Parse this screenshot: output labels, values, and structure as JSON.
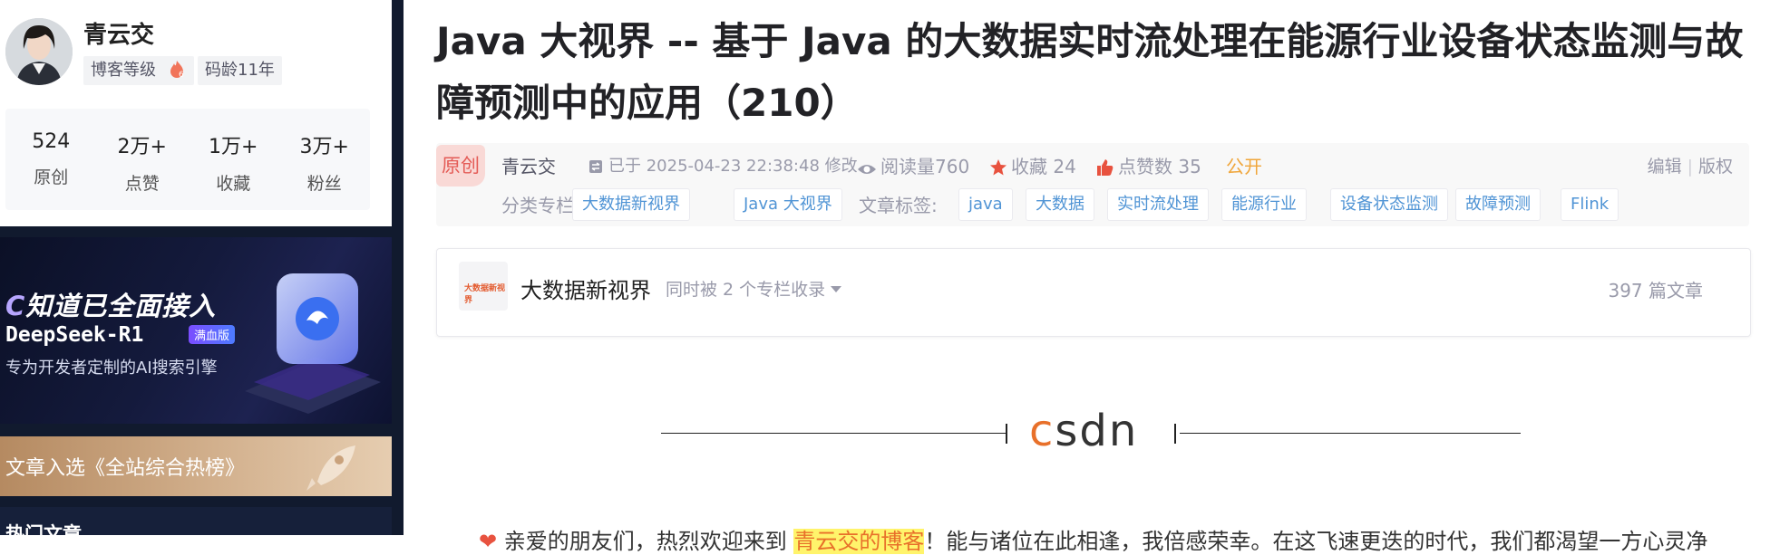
{
  "author": {
    "name": "青云交",
    "level_label": "博客等级",
    "age_label": "码龄11年"
  },
  "stats": [
    {
      "value": "524",
      "label": "原创"
    },
    {
      "value": "2万+",
      "label": "点赞"
    },
    {
      "value": "1万+",
      "label": "收藏"
    },
    {
      "value": "3万+",
      "label": "粉丝"
    }
  ],
  "ad": {
    "line1": "知道已全面接入",
    "line2": "DeepSeek-R1",
    "badge": "满血版",
    "line3": "专为开发者定制的AI搜索引擎"
  },
  "hot_banner": {
    "text": "文章入选《全站综合热榜》"
  },
  "sidebar_heading": "热门文章",
  "article": {
    "title": "Java 大视界 -- 基于 Java 的大数据实时流处理在能源行业设备状态监测与故障预测中的应用（210）",
    "original_badge": "原创",
    "author": "青云交",
    "time": "已于 2025-04-23 22:38:48 修改",
    "views": "阅读量760",
    "favorites": "收藏 24",
    "likes": "点赞数 35",
    "visibility": "公开",
    "edit": "编辑",
    "copyright": "版权",
    "category_label": "分类专栏:",
    "categories": [
      "大数据新视界",
      "Java 大视界"
    ],
    "tag_label": "文章标签:",
    "tags": [
      "java",
      "大数据",
      "实时流处理",
      "能源行业",
      "设备状态监测",
      "故障预测",
      "Flink"
    ]
  },
  "column": {
    "logo_text": "大数据新视界",
    "name": "大数据新视界",
    "included": "同时被 2 个专栏收录",
    "count": "397 篇文章"
  },
  "divider_logo": "csdn",
  "intro": {
    "before": "亲爱的朋友们，热烈欢迎来到 ",
    "highlight": "青云交的博客",
    "after": "！能与诸位在此相逢，我倍感荣幸。在这飞速更迭的时代，我们都渴望一方心灵净"
  },
  "colors": {
    "brand_orange": "#e8702a",
    "link_blue": "#5094d5",
    "public_orange": "#f0a63b",
    "original_red": "#e45b56"
  }
}
